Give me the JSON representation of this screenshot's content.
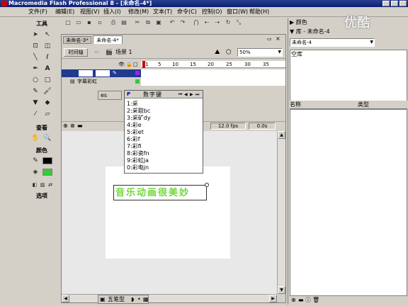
{
  "window": {
    "title": "Macromedia Flash Professional 8 - [未命名-4*]"
  },
  "menu": [
    "文件(F)",
    "编辑(E)",
    "视图(V)",
    "插入(I)",
    "修改(M)",
    "文本(T)",
    "命令(C)",
    "控制(O)",
    "窗口(W)",
    "帮助(H)"
  ],
  "tools": {
    "header": "工具",
    "view_label": "查看",
    "colors_label": "颜色",
    "options_label": "选项"
  },
  "doc_tabs": [
    "未命名-3*",
    "未命名-4*"
  ],
  "timeline": {
    "button": "时间轴",
    "scene": "场景 1",
    "zoom": "50%",
    "frame_numbers": [
      "1",
      "5",
      "10",
      "15",
      "20",
      "25",
      "30",
      "35"
    ],
    "layer_name": "字幕彩虹",
    "fps": "12.0 fps",
    "time": "0.0s"
  },
  "ime_popup": {
    "marker": "es",
    "title_icon": "P",
    "title": "数字键",
    "items": [
      "1:采",
      "2:采取bc",
      "3:采矿dy",
      "4:彩e",
      "5:彩et",
      "6:彩f",
      "7:彩fi",
      "8:彩瓷fn",
      "9:彩虹ja",
      "0:彩电jn"
    ]
  },
  "canvas": {
    "text": "音乐动画很美妙",
    "text_color": "#6fd83a"
  },
  "ime_status": {
    "mode": "五笔型"
  },
  "right_panel": {
    "colors_header": "颜色",
    "library_header": "库 - 未命名-4",
    "library_dropdown": "未命名-4",
    "empty_library": "空库",
    "col_name": "名称",
    "col_type": "类型"
  },
  "watermark": "优酷"
}
